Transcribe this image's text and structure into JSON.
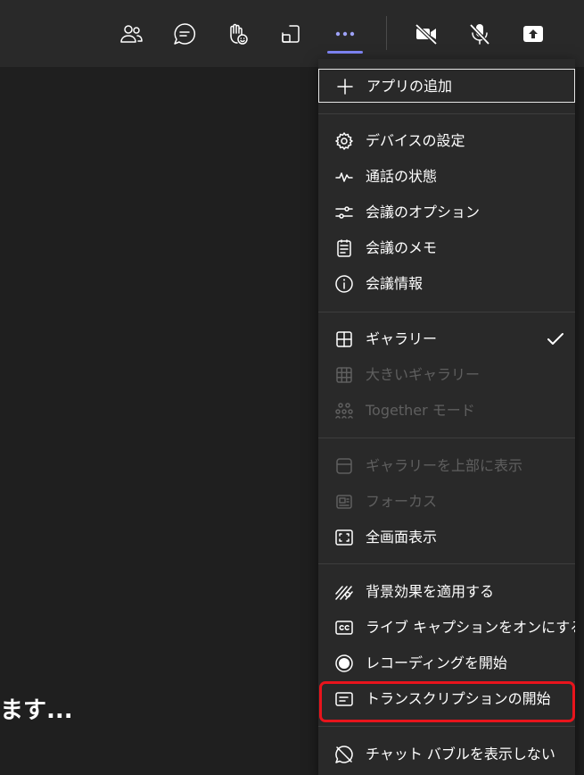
{
  "meeting": {
    "waiting_text": "ます..."
  },
  "toolbar": {
    "buttons": [
      {
        "name": "participants",
        "icon": "people-icon"
      },
      {
        "name": "chat",
        "icon": "chat-icon"
      },
      {
        "name": "reactions",
        "icon": "raise-hand-icon"
      },
      {
        "name": "rooms",
        "icon": "share-screen-icon"
      },
      {
        "name": "more",
        "icon": "more-icon"
      },
      {
        "name": "camera",
        "icon": "camera-off-icon"
      },
      {
        "name": "mic",
        "icon": "mic-off-icon"
      },
      {
        "name": "share",
        "icon": "share-tray-icon"
      }
    ],
    "accent_color": "#7f85f5"
  },
  "menu": {
    "sections": [
      {
        "items": [
          {
            "label": "アプリの追加",
            "icon": "plus-icon",
            "enabled": true,
            "focused": true
          }
        ]
      },
      {
        "items": [
          {
            "label": "デバイスの設定",
            "icon": "gear-icon",
            "enabled": true
          },
          {
            "label": "通話の状態",
            "icon": "pulse-icon",
            "enabled": true
          },
          {
            "label": "会議のオプション",
            "icon": "sliders-icon",
            "enabled": true
          },
          {
            "label": "会議のメモ",
            "icon": "notes-icon",
            "enabled": true
          },
          {
            "label": "会議情報",
            "icon": "info-icon",
            "enabled": true
          }
        ]
      },
      {
        "items": [
          {
            "label": "ギャラリー",
            "icon": "grid-icon",
            "enabled": true,
            "checked": true
          },
          {
            "label": "大きいギャラリー",
            "icon": "large-grid-icon",
            "enabled": false
          },
          {
            "label": "Together モード",
            "icon": "together-icon",
            "enabled": false
          }
        ]
      },
      {
        "items": [
          {
            "label": "ギャラリーを上部に表示",
            "icon": "gallery-top-icon",
            "enabled": false
          },
          {
            "label": "フォーカス",
            "icon": "focus-icon",
            "enabled": false
          },
          {
            "label": "全画面表示",
            "icon": "fullscreen-icon",
            "enabled": true
          }
        ]
      },
      {
        "items": [
          {
            "label": "背景効果を適用する",
            "icon": "background-effects-icon",
            "enabled": true
          },
          {
            "label": "ライブ キャプションをオンにする",
            "icon": "cc-icon",
            "enabled": true
          },
          {
            "label": "レコーディングを開始",
            "icon": "record-icon",
            "enabled": true
          },
          {
            "label": "トランスクリプションの開始",
            "icon": "transcript-icon",
            "enabled": true,
            "highlighted": true
          }
        ]
      },
      {
        "items": [
          {
            "label": "チャット バブルを表示しない",
            "icon": "hide-chat-bubble-icon",
            "enabled": true
          }
        ]
      }
    ],
    "highlight_color": "#e8141c"
  }
}
